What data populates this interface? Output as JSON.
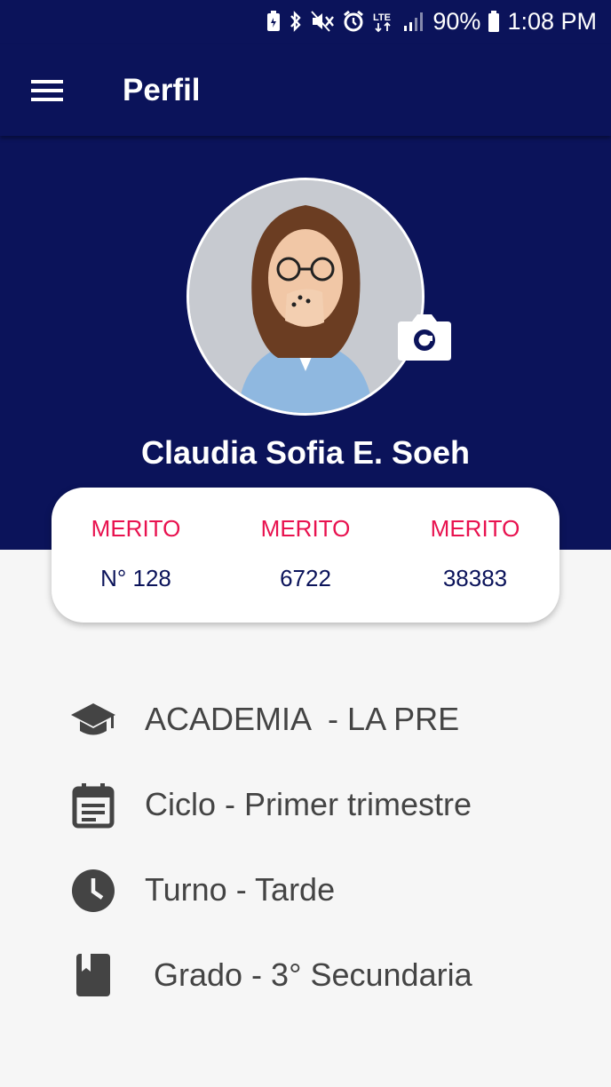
{
  "status_bar": {
    "battery": "90%",
    "time": "1:08 PM",
    "network": "LTE",
    "icons": [
      "battery-saver-icon",
      "bluetooth-icon",
      "mute-icon",
      "alarm-icon",
      "lte-icon",
      "signal-icon",
      "battery-icon"
    ]
  },
  "app_bar": {
    "title": "Perfil",
    "menu_icon": "hamburger-menu-icon"
  },
  "profile": {
    "name": "Claudia Sofia E. Soeh",
    "camera_icon": "camera-icon"
  },
  "stats": [
    {
      "label": "MERITO",
      "value": "N° 128"
    },
    {
      "label": "MERITO",
      "value": "6722"
    },
    {
      "label": "MERITO",
      "value": "38383"
    }
  ],
  "info": [
    {
      "icon": "graduation-cap-icon",
      "text": "ACADEMIA  - LA PRE"
    },
    {
      "icon": "calendar-icon",
      "text": "Ciclo - Primer trimestre"
    },
    {
      "icon": "clock-icon",
      "text": "Turno - Tarde"
    },
    {
      "icon": "book-icon",
      "text": " Grado - 3° Secundaria"
    }
  ],
  "colors": {
    "primary": "#0b135a",
    "accent": "#e8124f",
    "background": "#f6f6f6",
    "icon": "#444444"
  }
}
